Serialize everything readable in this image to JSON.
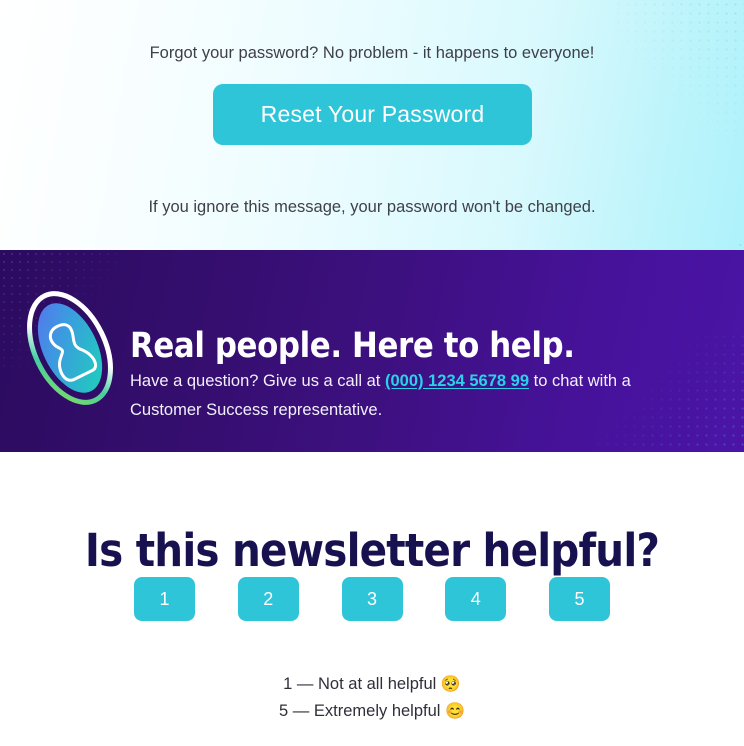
{
  "reset": {
    "lead_text": "Forgot your password? No problem - it happens to everyone!",
    "button_label": "Reset Your Password",
    "ignore_text": "If you ignore this message, your password won't be changed.",
    "accent_color": "#2ec5d9",
    "text_color": "#3f3f4a"
  },
  "help": {
    "heading": "Real people. Here to help.",
    "body_before": "Have a question? Give us a call at ",
    "phone": "(000) 1234 5678 99",
    "body_after": " to chat with a Customer Success representative.",
    "logo_name": "person-in-ellipse-logo",
    "background_start": "#2b0b5f",
    "background_end": "#4b14a6",
    "link_color": "#2ad2e8"
  },
  "rating": {
    "heading": "Is this newsletter helpful?",
    "heading_color": "#171150",
    "button_color": "#2ec5d9",
    "options": [
      {
        "value": "1"
      },
      {
        "value": "2"
      },
      {
        "value": "3"
      },
      {
        "value": "4"
      },
      {
        "value": "5"
      }
    ],
    "legend": [
      {
        "text": "1 — Not at all helpful ",
        "emoji": "🥺"
      },
      {
        "text": "5 — Extremely helpful ",
        "emoji": "😊"
      }
    ]
  }
}
